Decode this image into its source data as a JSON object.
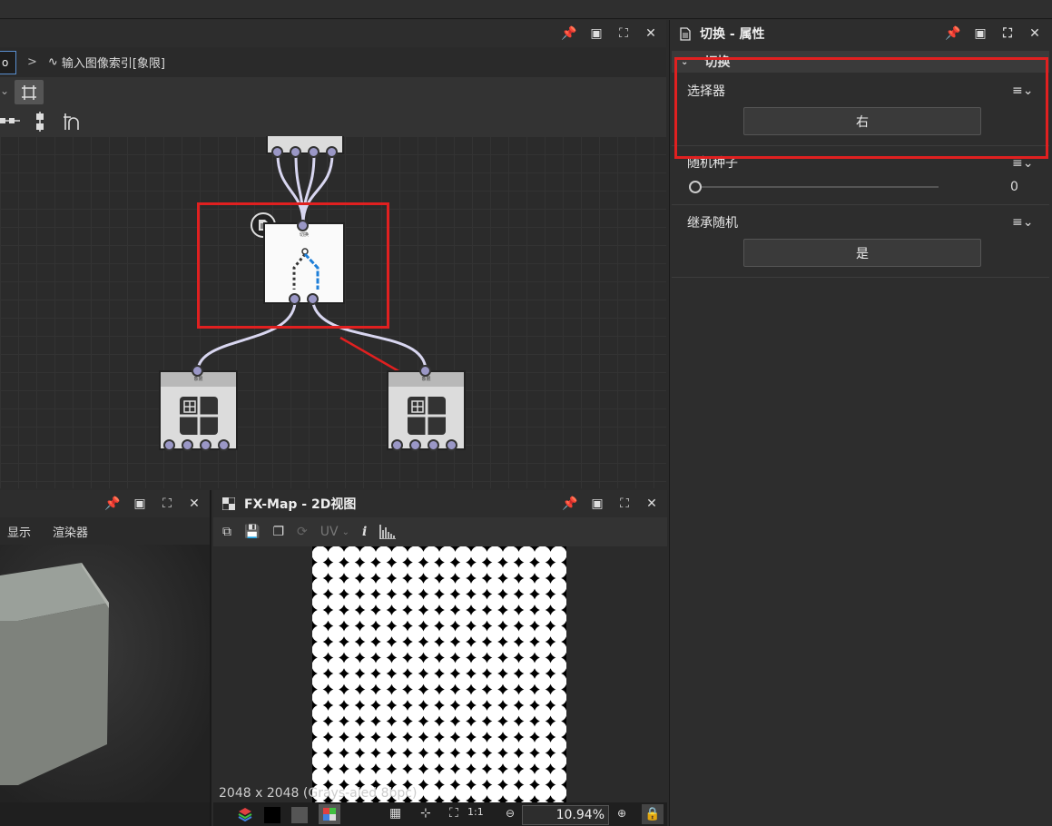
{
  "breadcrumb": {
    "prev_crumb": "o",
    "separator": ">",
    "current": "输入图像索引[象限]"
  },
  "graph_nodes": {
    "switch_node_label": "切换",
    "left_output_label": "象限",
    "right_output_label": "象限"
  },
  "properties": {
    "title": "切换 - 属性",
    "section": "切换",
    "selector_label": "选择器",
    "selector_value": "右",
    "random_seed_label": "随机种子",
    "random_seed_value": "0",
    "inherit_random_label": "继承随机",
    "inherit_random_value": "是"
  },
  "view3d": {
    "menu_display": "显示",
    "menu_renderer": "渲染器"
  },
  "view2d": {
    "title": "FX-Map - 2D视图",
    "uv_label": "UV",
    "resolution": "2048 x 2048 (Grays-aled 8bpc)",
    "zoom": "10.94%"
  },
  "colors": {
    "highlight_red": "#e02020",
    "port": "#9a97c6",
    "wire": "#d8d6f0",
    "accent_blue": "#1e7fd8"
  }
}
